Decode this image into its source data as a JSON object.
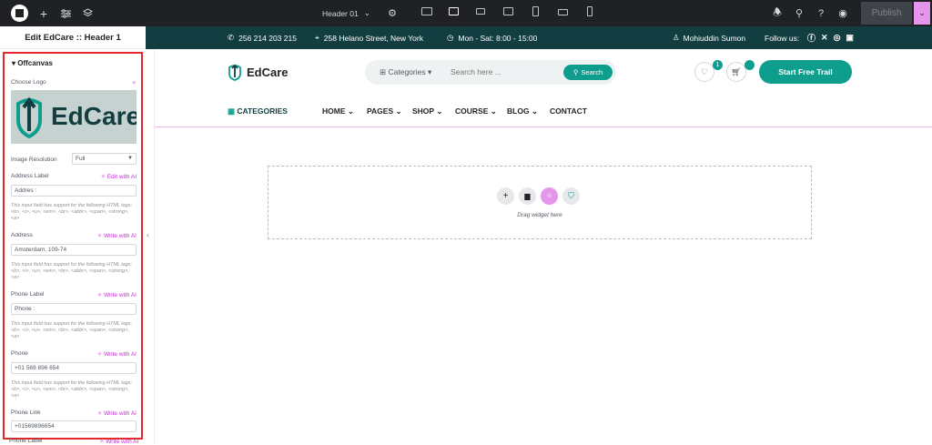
{
  "topbar": {
    "doc_name": "Header 01",
    "publish_label": "Publish"
  },
  "panel": {
    "title": "Edit EdCare :: Header 1",
    "section": "Offcanvas",
    "choose_logo_label": "Choose Logo",
    "logo_text": "EdCare",
    "image_resolution_label": "Image Resolution",
    "image_resolution_value": "Full",
    "hint": "This input field has support for the following HTML tags: <b>, <i>, <u>, <em>, <br>, <abbr>, <span>, <strong>, <a>",
    "fields": [
      {
        "label": "Address Label",
        "ai": "Edit with AI",
        "value": "Addres :"
      },
      {
        "label": "Address",
        "ai": "Write with AI",
        "value": "Amsterdam, 109-74"
      },
      {
        "label": "Phone Label",
        "ai": "Write with AI",
        "value": "Phone :"
      },
      {
        "label": "Phone",
        "ai": "Write with AI",
        "value": "+01 569 896 654"
      },
      {
        "label": "Phone Link",
        "ai": "Write with AI",
        "value": "+01569896654"
      }
    ],
    "below_label": "Phone Label",
    "below_ai": "Write with AI"
  },
  "topstrip": {
    "phone": "256 214 203 215",
    "address": "258 Helano Street, New York",
    "hours": "Mon - Sat: 8:00 - 15:00",
    "user": "Mohiuddin Sumon",
    "follow": "Follow us:"
  },
  "header": {
    "brand": "EdCare",
    "categories_label": "Categories",
    "search_placeholder": "Search here ...",
    "search_button": "Search",
    "wishlist_count": "1",
    "cta": "Start Free Trail"
  },
  "nav": {
    "categories": "CATEGORIES",
    "items": [
      "HOME",
      "PAGES",
      "SHOP",
      "COURSE",
      "BLOG",
      "CONTACT"
    ]
  },
  "dropzone": {
    "hint": "Drag widget here"
  },
  "colors": {
    "teal_dark": "#133e41",
    "teal": "#0f9e8e",
    "ai_pink": "#c42fd4",
    "selection_red": "#e5262a"
  }
}
